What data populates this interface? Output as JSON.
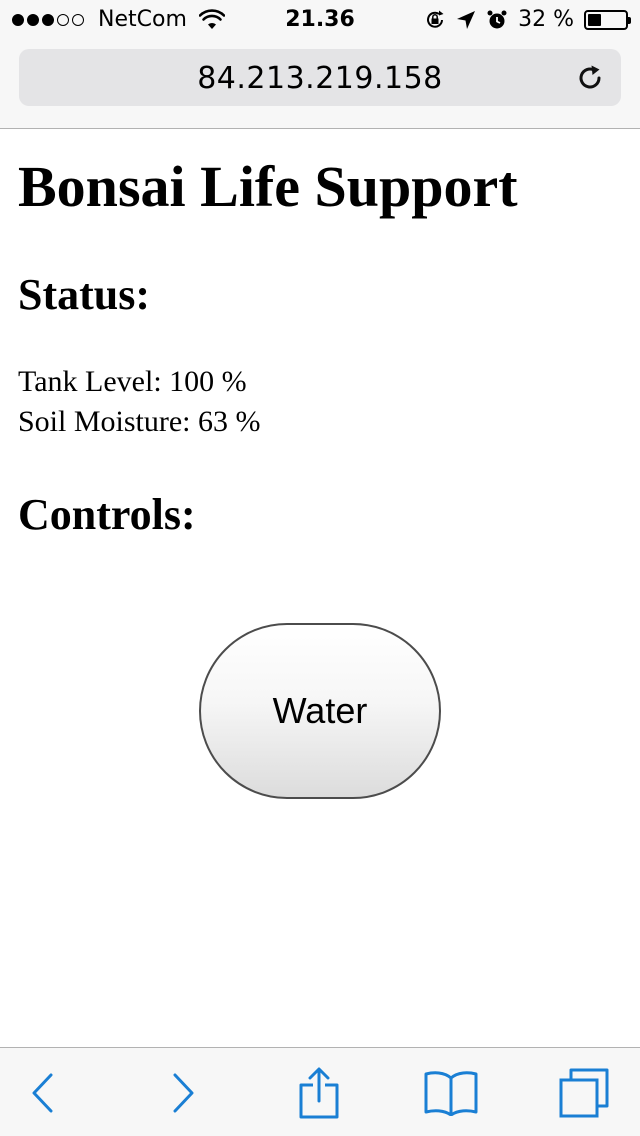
{
  "status_bar": {
    "carrier": "NetCom",
    "time": "21.36",
    "battery_text": "32 %",
    "battery_level": 0.32,
    "signal_strength": 3,
    "signal_max": 5
  },
  "browser": {
    "url": "84.213.219.158",
    "accent_color": "#1a7fd4"
  },
  "page": {
    "title": "Bonsai Life Support",
    "status_heading": "Status:",
    "tank_level": "Tank Level: 100 %",
    "soil_moisture": "Soil Moisture: 63 %",
    "controls_heading": "Controls:",
    "water_button_label": "Water"
  },
  "toolbar": {
    "icons": [
      "back-icon",
      "forward-icon",
      "share-icon",
      "bookmarks-icon",
      "tabs-icon"
    ]
  }
}
